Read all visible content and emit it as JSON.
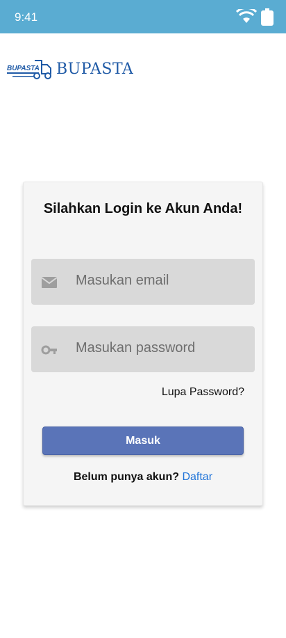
{
  "status_bar": {
    "time": "9:41",
    "color": "#5aacd2"
  },
  "brand": {
    "logo_text": "BUPASTA",
    "logo_tag": "BUPASTA"
  },
  "login": {
    "title": "Silahkan Login ke Akun Anda!",
    "email_placeholder": "Masukan email",
    "password_placeholder": "Masukan password",
    "forgot_label": "Lupa Password?",
    "submit_label": "Masuk",
    "signup_prompt": "Belum punya akun?",
    "signup_link": "Daftar",
    "button_color": "#5a74b8",
    "link_color": "#1f73d8"
  },
  "icons": [
    "wifi-icon",
    "battery-icon",
    "mail-icon",
    "key-icon",
    "truck-icon"
  ]
}
